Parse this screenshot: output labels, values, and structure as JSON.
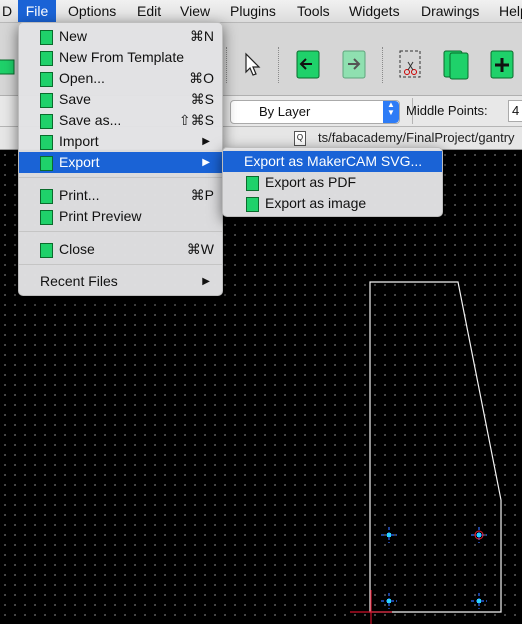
{
  "menubar": {
    "items": [
      {
        "label": "D"
      },
      {
        "label": "File"
      },
      {
        "label": "Options"
      },
      {
        "label": "Edit"
      },
      {
        "label": "View"
      },
      {
        "label": "Plugins"
      },
      {
        "label": "Tools"
      },
      {
        "label": "Widgets"
      },
      {
        "label": "Drawings"
      },
      {
        "label": "Help"
      }
    ]
  },
  "options": {
    "layer_value": "By Layer",
    "middle_points_label": "Middle Points:",
    "middle_points_value": "4"
  },
  "path": "ts/fabacademy/FinalProject/gantry",
  "file_menu": {
    "new": {
      "label": "New",
      "shortcut": "⌘N"
    },
    "new_template": {
      "label": "New From Template"
    },
    "open": {
      "label": "Open...",
      "shortcut": "⌘O"
    },
    "save": {
      "label": "Save",
      "shortcut": "⌘S"
    },
    "save_as": {
      "label": "Save as...",
      "shortcut": "⇧⌘S"
    },
    "import": {
      "label": "Import"
    },
    "export": {
      "label": "Export"
    },
    "print": {
      "label": "Print...",
      "shortcut": "⌘P"
    },
    "print_preview": {
      "label": "Print Preview"
    },
    "close": {
      "label": "Close",
      "shortcut": "⌘W"
    },
    "recent": {
      "label": "Recent Files"
    }
  },
  "export_menu": {
    "makercam": {
      "label": "Export as MakerCAM SVG..."
    },
    "pdf": {
      "label": "Export as PDF"
    },
    "image": {
      "label": "Export as image"
    }
  },
  "colors": {
    "highlight": "#1a63d6",
    "icon_green": "#1fd16a",
    "canvas": "#000000"
  }
}
